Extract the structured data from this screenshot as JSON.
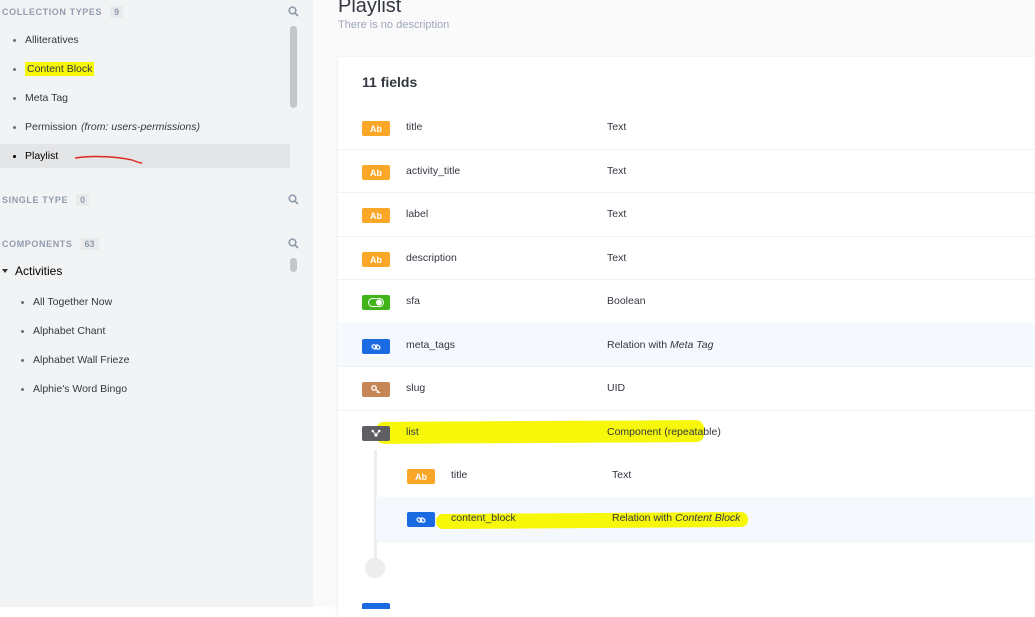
{
  "sidebar": {
    "collection_types": {
      "title": "Collection Types",
      "count": "9",
      "items": [
        {
          "label": "Alliteratives"
        },
        {
          "label": "Content Block"
        },
        {
          "label": "Meta Tag"
        },
        {
          "label": "Permission",
          "suffix": "(from: users-permissions)"
        },
        {
          "label": "Playlist"
        }
      ]
    },
    "single_type": {
      "title": "Single Type",
      "count": "0"
    },
    "components": {
      "title": "Components",
      "count": "63",
      "group": "Activities",
      "items": [
        {
          "label": "All Together Now"
        },
        {
          "label": "Alphabet Chant"
        },
        {
          "label": "Alphabet Wall Frieze"
        },
        {
          "label": "Alphie's Word Bingo"
        }
      ]
    }
  },
  "main": {
    "title": "Playlist",
    "description": "There is no description",
    "fields_count": "11 fields",
    "fields": [
      {
        "badge": "Ab",
        "name": "title",
        "type": "Text"
      },
      {
        "badge": "Ab",
        "name": "activity_title",
        "type": "Text"
      },
      {
        "badge": "Ab",
        "name": "label",
        "type": "Text"
      },
      {
        "badge": "Ab",
        "name": "description",
        "type": "Text"
      },
      {
        "badge": "",
        "name": "sfa",
        "type": "Boolean"
      },
      {
        "badge": "",
        "name": "meta_tags",
        "type": "Relation with",
        "type_target": "Meta Tag"
      },
      {
        "badge": "",
        "name": "slug",
        "type": "UID"
      },
      {
        "badge": "",
        "name": "list",
        "type": "Component (repeatable)"
      }
    ],
    "sub_fields": [
      {
        "badge": "Ab",
        "name": "title",
        "type": "Text"
      },
      {
        "badge": "",
        "name": "content_block",
        "type": "Relation with",
        "type_target": "Content Block"
      }
    ]
  },
  "colors": {
    "highlight": "#f7f70a",
    "text_badge": "#faa727",
    "boolean_badge": "#41b41a",
    "relation_badge": "#1a6be2",
    "uid_badge": "#c68656",
    "component_badge": "#5e5f62",
    "annotation_red": "#e0261b"
  }
}
